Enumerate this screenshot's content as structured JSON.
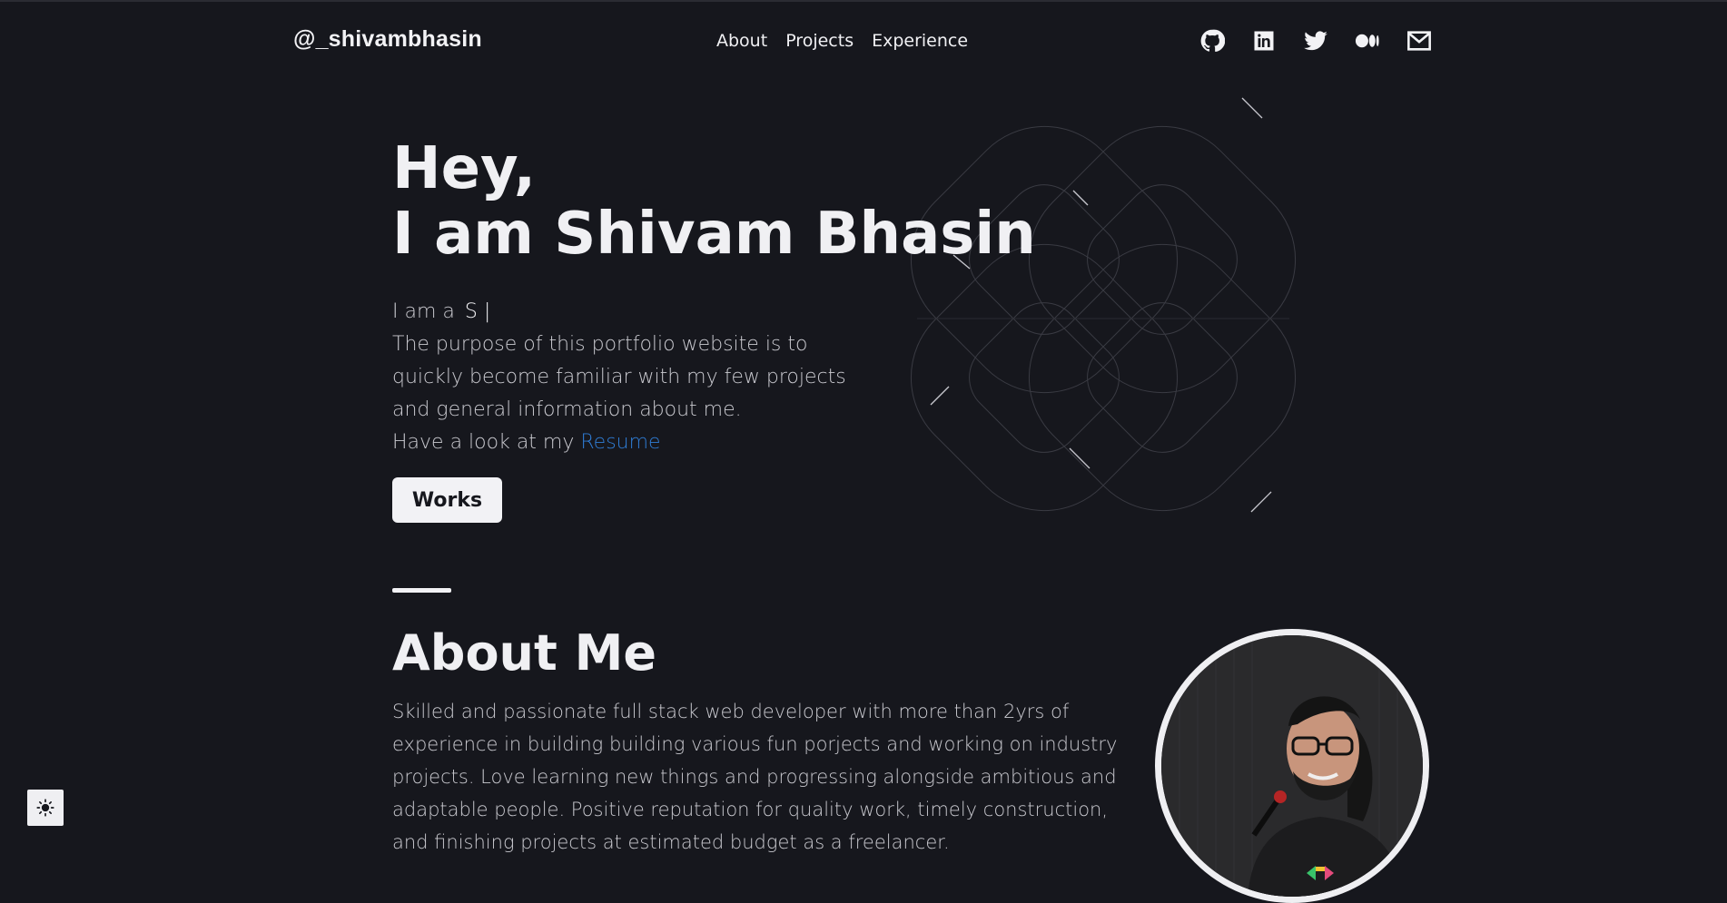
{
  "header": {
    "logo": "@_shivambhasin",
    "nav": [
      "About",
      "Projects",
      "Experience"
    ],
    "socials": [
      "github-icon",
      "linkedin-icon",
      "twitter-icon",
      "medium-icon",
      "mail-icon"
    ]
  },
  "hero": {
    "line1": "Hey,",
    "line2": "I am Shivam Bhasin",
    "intro_prefix": "I am a",
    "typed_text": "S |",
    "description": "The purpose of this portfolio website is to quickly become familiar with my few projects and general information about me.",
    "resume_prefix": "Have a look at my",
    "resume_link": "Resume",
    "works_button": "Works"
  },
  "about": {
    "title": "About Me",
    "text": "Skilled and passionate full stack web developer with more than 2yrs of experience in building building various fun porjects and working on industry projects. Love learning new things and progressing alongside ambitious and adaptable people. Positive reputation for quality work, timely construction, and finishing projects at estimated budget as a freelancer."
  },
  "theme_toggle": {
    "icon": "sun-icon"
  },
  "colors": {
    "background": "#16171d",
    "text": "#f0f0f3",
    "muted_text": "#c9c9cf",
    "link": "#2f7dd6"
  }
}
